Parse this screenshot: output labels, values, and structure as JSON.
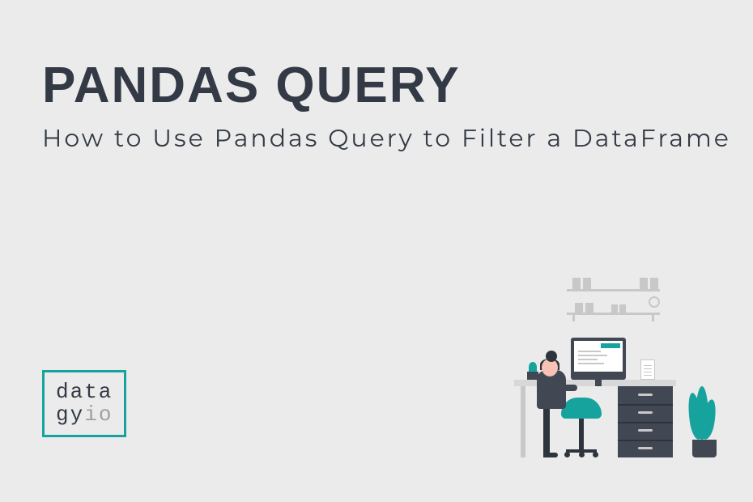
{
  "heading": "PANDAS QUERY",
  "subtitle": "How to Use Pandas Query to Filter a DataFrame",
  "logo": {
    "line1": "data",
    "line2_main": "gy",
    "line2_accent": "io"
  },
  "colors": {
    "background": "#ebebeb",
    "text": "#333a45",
    "accent": "#16a39e",
    "muted": "#a0a0a0"
  }
}
